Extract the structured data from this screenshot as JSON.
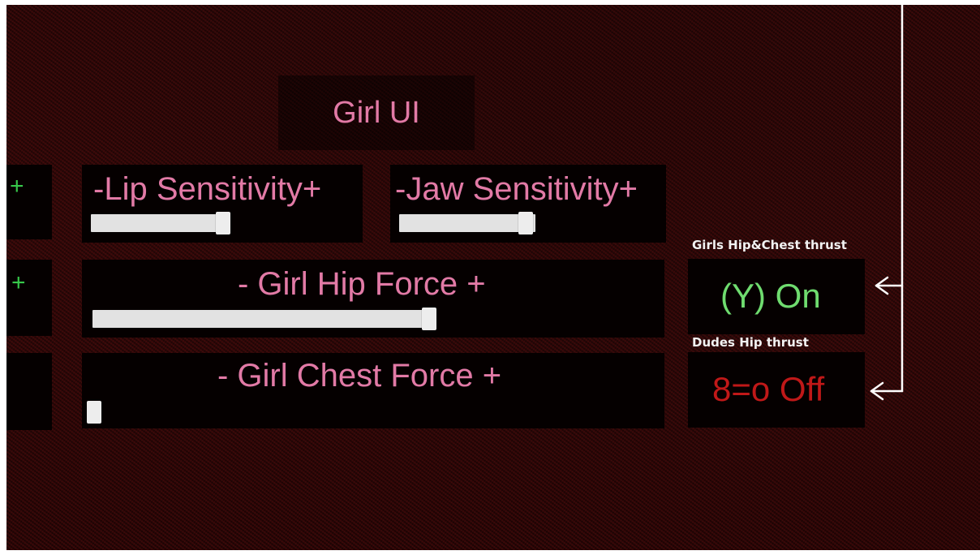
{
  "title": "Girl UI",
  "left_stub_plus_1": "+",
  "left_stub_plus_2": "+",
  "sliders": {
    "lip": {
      "label": "-Lip Sensitivity+",
      "value": 0.97
    },
    "jaw": {
      "label": "-Jaw Sensitivity+",
      "value": 0.93
    },
    "hip": {
      "label": "- Girl Hip Force +",
      "value": 0.98
    },
    "chest": {
      "label": "- Girl Chest Force +",
      "value": 0.0
    }
  },
  "toggles": {
    "girls_thrust": {
      "caption": "Girls Hip&Chest thrust",
      "value": "(Y) On",
      "color": "#6fdc6f"
    },
    "dudes_thrust": {
      "caption": "Dudes Hip thrust",
      "value": "8=o Off",
      "color": "#c01818"
    }
  },
  "colors": {
    "label_pink": "#e27aa6",
    "arrow": "#ffffff"
  }
}
